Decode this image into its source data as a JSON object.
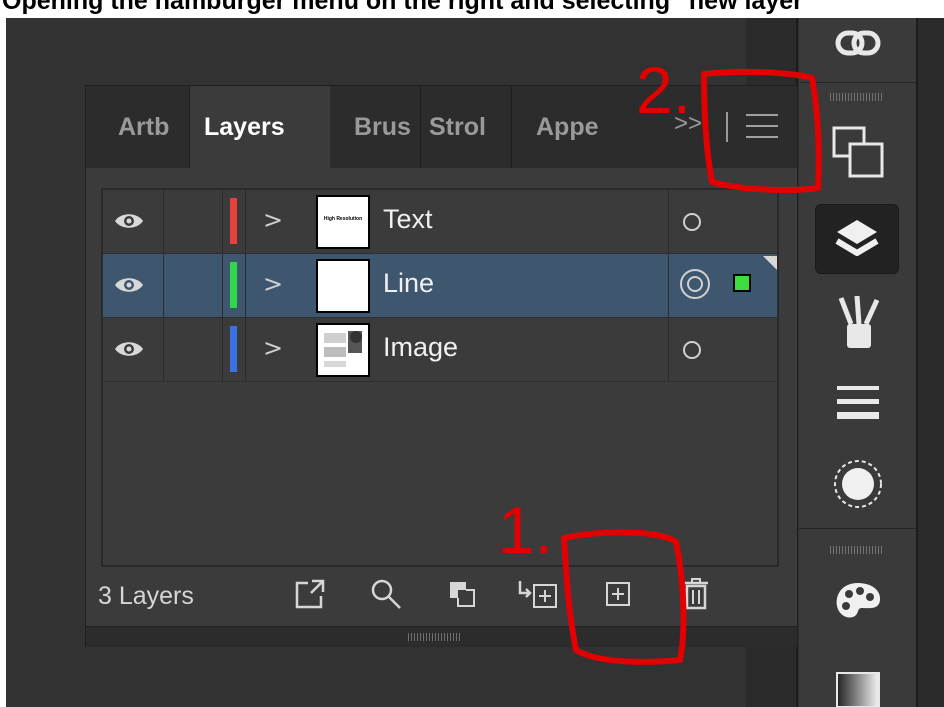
{
  "caption": "Opening the hamburger menu on the right and selecting \"new layer\"",
  "panel": {
    "tabs": [
      {
        "label": "Artb",
        "active": false
      },
      {
        "label": "Layers",
        "active": true
      },
      {
        "label": "Brus",
        "active": false
      },
      {
        "label": "Strol",
        "active": false
      },
      {
        "label": "Appe",
        "active": false
      }
    ],
    "overflow_label": ">>",
    "menu_icon": "hamburger-menu-icon"
  },
  "layers": [
    {
      "name": "Text",
      "color": "#e8403c",
      "thumb_label": "High Resolution",
      "selected": false
    },
    {
      "name": "Line",
      "color": "#2ed84a",
      "thumb_label": "",
      "selected": true
    },
    {
      "name": "Image",
      "color": "#3a72e6",
      "thumb_label": "",
      "selected": false
    }
  ],
  "footer": {
    "layer_count": "3 Layers",
    "icons": [
      "export-icon",
      "search-icon",
      "clipping-mask-icon",
      "new-sublayer-icon",
      "new-layer-icon",
      "trash-icon"
    ]
  },
  "annotations": {
    "step1_label": "1.",
    "step2_label": "2.",
    "color": "#e30000"
  },
  "toolbar_icons": [
    "link-icon",
    "artboards-icon",
    "layers-icon",
    "brushes-icon",
    "stroke-icon",
    "appearance-icon",
    "color-palette-icon",
    "gradient-icon"
  ]
}
